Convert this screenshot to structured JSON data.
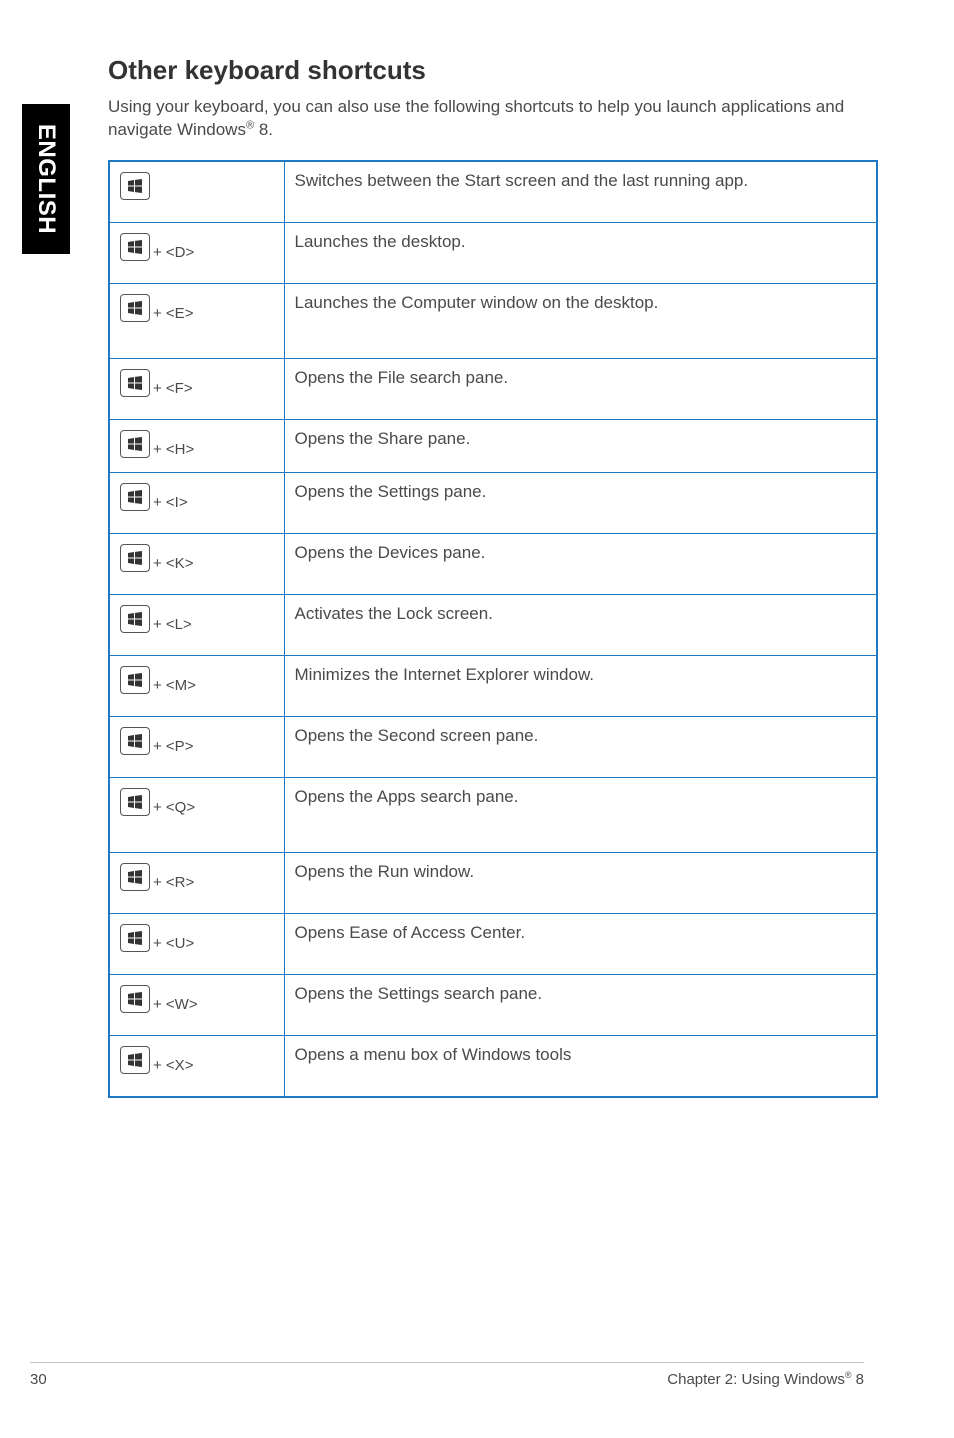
{
  "side_tab": "ENGLISH",
  "heading": "Other keyboard shortcuts",
  "intro_part1": "Using your keyboard, you can also use the following shortcuts to help you launch applications and navigate Windows",
  "intro_sup": "®",
  "intro_part2": " 8.",
  "shortcuts": [
    {
      "key_suffix": "",
      "desc": "Switches between the Start screen and the last running app."
    },
    {
      "key_suffix": " + <D>",
      "desc": "Launches the desktop."
    },
    {
      "key_suffix": " + <E>",
      "desc": "Launches the Computer window on the desktop."
    },
    {
      "key_suffix": " + <F>",
      "desc": "Opens the File search pane."
    },
    {
      "key_suffix": " + <H>",
      "desc": "Opens the Share pane."
    },
    {
      "key_suffix": " + <I>",
      "desc": "Opens the Settings pane."
    },
    {
      "key_suffix": " + <K>",
      "desc": "Opens the Devices pane."
    },
    {
      "key_suffix": " + <L>",
      "desc": "Activates the Lock screen."
    },
    {
      "key_suffix": " + <M>",
      "desc": "Minimizes the Internet Explorer window."
    },
    {
      "key_suffix": " + <P>",
      "desc": "Opens the Second screen pane."
    },
    {
      "key_suffix": " + <Q>",
      "desc": "Opens the Apps search pane."
    },
    {
      "key_suffix": " + <R>",
      "desc": "Opens the Run window."
    },
    {
      "key_suffix": " + <U>",
      "desc": "Opens Ease of Access Center."
    },
    {
      "key_suffix": " + <W>",
      "desc": "Opens the Settings search pane."
    },
    {
      "key_suffix": " + <X>",
      "desc": "Opens a menu box of Windows tools"
    }
  ],
  "footer": {
    "page_number": "30",
    "chapter_part1": "Chapter 2: Using Windows",
    "chapter_sup": "®",
    "chapter_part2": " 8"
  }
}
